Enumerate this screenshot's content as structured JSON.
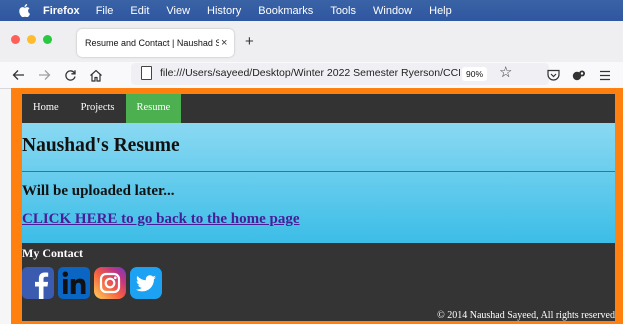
{
  "menubar": {
    "app": "Firefox",
    "items": [
      "File",
      "Edit",
      "View",
      "History",
      "Bookmarks",
      "Tools",
      "Window",
      "Help"
    ]
  },
  "tab": {
    "title": "Resume and Contact | Naushad Saye",
    "close_glyph": "×",
    "new_tab_glyph": "+"
  },
  "toolbar": {
    "url": "file:///Users/sayeed/Desktop/Winter 2022 Semester Ryerson/CCPS",
    "zoom": "90%"
  },
  "colors": {
    "accent_orange": "#ff7f0f",
    "nav_active": "#4caf50",
    "hero_top": "#8ad9f2",
    "hero_bottom": "#3cbde7",
    "dark_bg": "#343434"
  },
  "site": {
    "nav": [
      "Home",
      "Projects",
      "Resume"
    ],
    "active_nav": "Resume",
    "heading": "Naushad's Resume",
    "subheading": "Will be uploaded later...",
    "home_link": "CLICK HERE to go back to the home page",
    "contact_heading": "My Contact",
    "social_icons": [
      "facebook-icon",
      "linkedin-icon",
      "instagram-icon",
      "twitter-icon"
    ],
    "footer": "© 2014 Naushad Sayeed, All rights reserved"
  }
}
